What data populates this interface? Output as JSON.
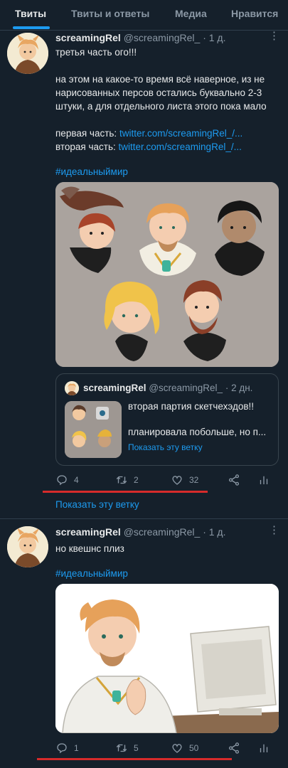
{
  "tabs": [
    "Твиты",
    "Твиты и ответы",
    "Медиа",
    "Нравится"
  ],
  "tweets": [
    {
      "name": "screamingRel",
      "handle": "@screamingRel_",
      "time": "· 1 д.",
      "lines": [
        "третья часть ого!!!",
        "",
        "на этом на какое-то время всё наверное, из не",
        "нарисованных персов остались буквально 2-3",
        "штуки, а для отдельного листа этого пока мало",
        "",
        "первая часть:",
        "вторая часть:"
      ],
      "link1": "twitter.com/screamingRel_/...",
      "link2": "twitter.com/screamingRel_/...",
      "hashtag": "#идеальныймир",
      "quote": {
        "name": "screamingRel",
        "handle": "@screamingRel_",
        "time": "· 2 дн.",
        "line1": "вторая партия скетчехэдов!!",
        "line2": "планировала побольше, но п...",
        "show_thread": "Показать эту ветку"
      },
      "stats": {
        "replies": "4",
        "retweets": "2",
        "likes": "32"
      },
      "show_thread": "Показать эту ветку"
    },
    {
      "name": "screamingRel",
      "handle": "@screamingRel_",
      "time": "· 1 д.",
      "text": "но квешнс плиз",
      "hashtag": "#идеальныймир",
      "stats": {
        "replies": "1",
        "retweets": "5",
        "likes": "50"
      }
    }
  ],
  "colors": {
    "background": "#15202b",
    "accent": "#1d9bf0",
    "muted": "#8b98a5",
    "highlight_underline": "#d62b2b"
  },
  "icons": [
    "reply-icon",
    "retweet-icon",
    "like-icon",
    "share-icon",
    "analytics-icon",
    "more-icon"
  ]
}
